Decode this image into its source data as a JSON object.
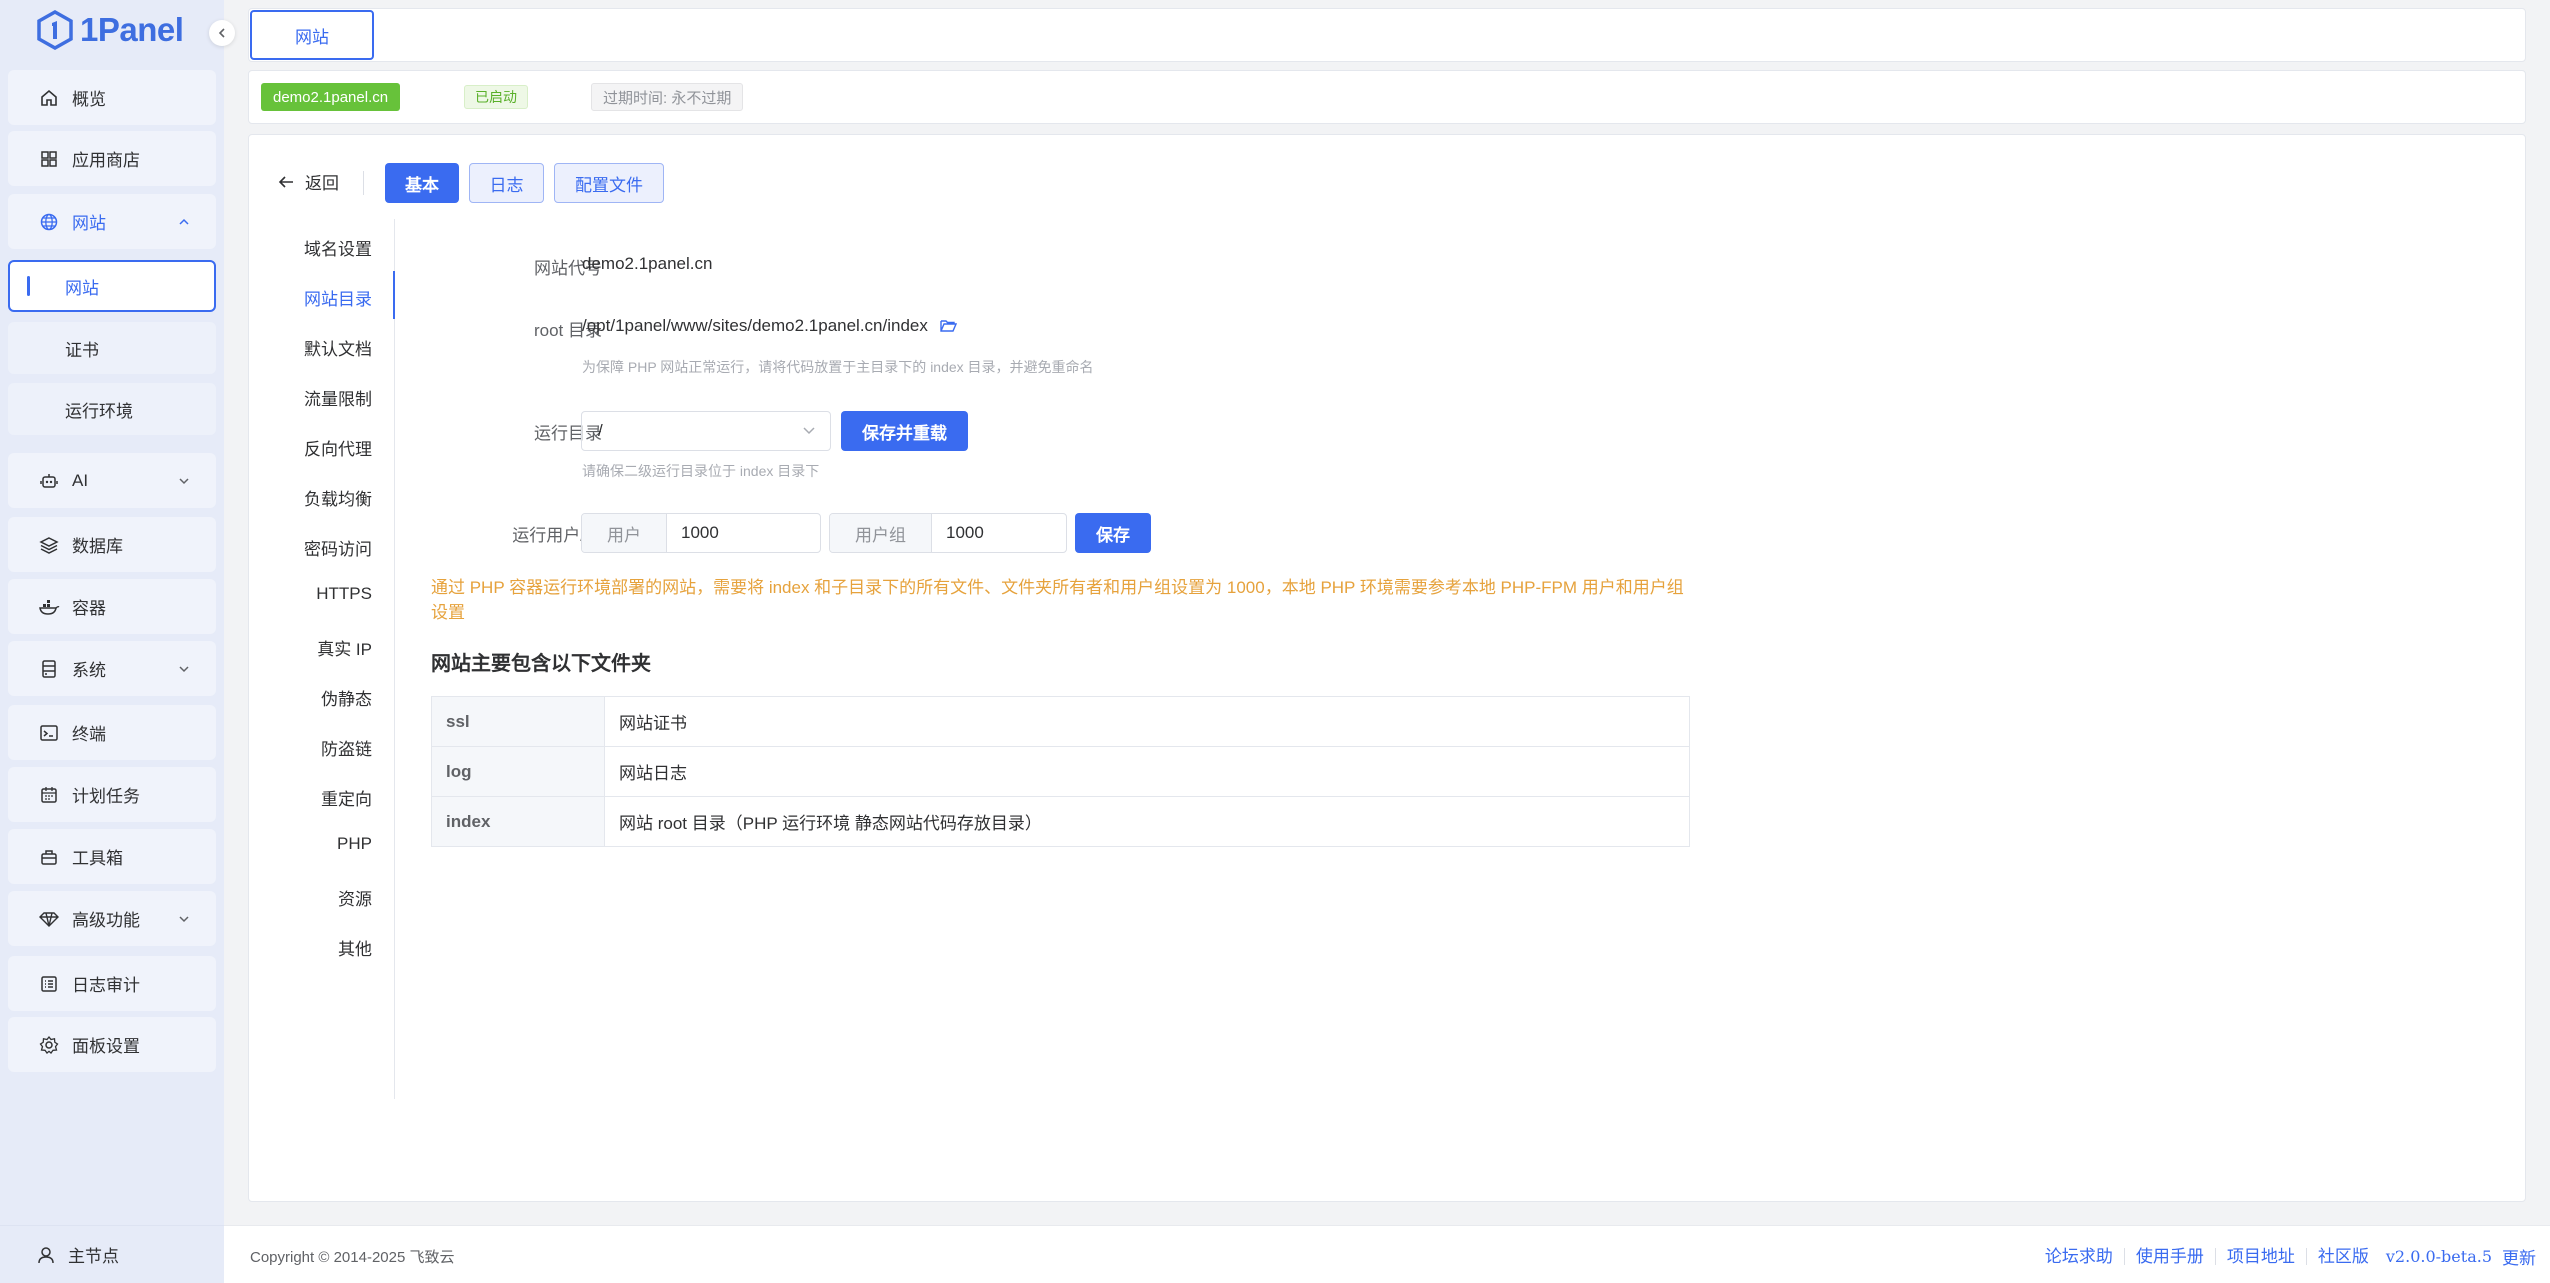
{
  "brand": {
    "name": "1Panel"
  },
  "sidebar": {
    "items": [
      {
        "label": "概览",
        "icon": "home-icon"
      },
      {
        "label": "应用商店",
        "icon": "grid-icon"
      },
      {
        "label": "网站",
        "icon": "globe-icon",
        "expanded": true,
        "children": [
          {
            "label": "网站",
            "active": true
          },
          {
            "label": "证书"
          },
          {
            "label": "运行环境"
          }
        ]
      },
      {
        "label": "AI",
        "icon": "robot-icon"
      },
      {
        "label": "数据库",
        "icon": "layers-icon"
      },
      {
        "label": "容器",
        "icon": "container-icon"
      },
      {
        "label": "系统",
        "icon": "server-icon"
      },
      {
        "label": "终端",
        "icon": "terminal-icon"
      },
      {
        "label": "计划任务",
        "icon": "calendar-icon"
      },
      {
        "label": "工具箱",
        "icon": "toolbox-icon"
      },
      {
        "label": "高级功能",
        "icon": "diamond-icon"
      },
      {
        "label": "日志审计",
        "icon": "log-icon"
      },
      {
        "label": "面板设置",
        "icon": "gear-icon"
      }
    ],
    "bottom_node": "主节点"
  },
  "tabs": [
    {
      "label": "网站",
      "active": true
    }
  ],
  "site_info": {
    "domain": "demo2.1panel.cn",
    "status": "已启动",
    "expire": "过期时间: 永不过期"
  },
  "toolbar": {
    "back": "返回",
    "buttons": [
      {
        "label": "基本",
        "active": true
      },
      {
        "label": "日志",
        "active": false
      },
      {
        "label": "配置文件",
        "active": false
      }
    ]
  },
  "subnav": [
    "域名设置",
    "网站目录",
    "默认文档",
    "流量限制",
    "反向代理",
    "负载均衡",
    "密码访问",
    "HTTPS",
    "真实 IP",
    "伪静态",
    "防盗链",
    "重定向",
    "PHP",
    "资源",
    "其他"
  ],
  "subnav_active": "网站目录",
  "form": {
    "alias_label": "网站代号",
    "alias_value": "demo2.1panel.cn",
    "root_label": "root 目录",
    "root_value": "/opt/1panel/www/sites/demo2.1panel.cn/index",
    "root_hint": "为保障 PHP 网站正常运行，请将代码放置于主目录下的 index 目录，并避免重命名",
    "run_dir_label": "运行目录",
    "run_dir_value": "/",
    "run_dir_button": "保存并重载",
    "run_dir_hint": "请确保二级运行目录位于 index 目录下",
    "user_group_label": "运行用户/组",
    "user_prefix": "用户",
    "user_value": "1000",
    "group_prefix": "用户组",
    "group_value": "1000",
    "save_button": "保存"
  },
  "warning": "通过 PHP 容器运行环境部署的网站，需要将 index 和子目录下的所有文件、文件夹所有者和用户组设置为 1000，本地 PHP 环境需要参考本地 PHP-FPM 用户和用户组设置",
  "folders": {
    "title": "网站主要包含以下文件夹",
    "rows": [
      {
        "name": "ssl",
        "desc": "网站证书"
      },
      {
        "name": "log",
        "desc": "网站日志"
      },
      {
        "name": "index",
        "desc": "网站 root 目录（PHP 运行环境 静态网站代码存放目录）"
      }
    ]
  },
  "footer": {
    "copyright": "Copyright © 2014-2025 飞致云",
    "links": [
      "论坛求助",
      "使用手册",
      "项目地址",
      "社区版"
    ],
    "version": "v2.0.0-beta.5",
    "update": "更新"
  },
  "colors": {
    "primary": "#3a6bf0",
    "success": "#67c23a",
    "warning": "#e6a23c",
    "sidebar_bg": "#e6ebf8"
  }
}
